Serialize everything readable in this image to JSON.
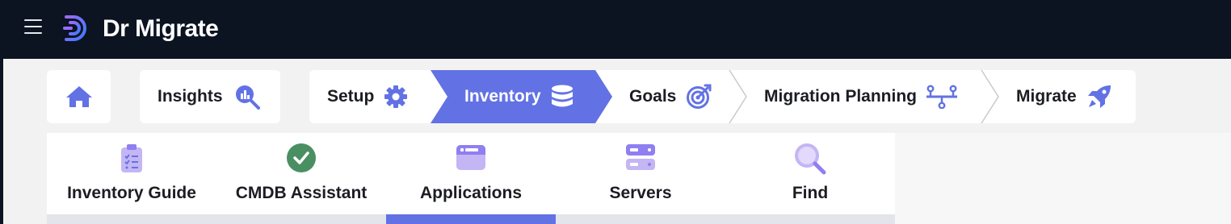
{
  "app": {
    "brand": "Dr Migrate"
  },
  "colors": {
    "accent": "#6272e4",
    "topbar": "#0c1321",
    "success": "#4a8f62",
    "icon_light": "#c4b5f4"
  },
  "breadcrumb": {
    "home": {
      "icon": "home-icon"
    },
    "insights": {
      "label": "Insights",
      "icon": "insights-chart-icon"
    }
  },
  "steps": [
    {
      "label": "Setup",
      "icon": "gear-icon",
      "active": false
    },
    {
      "label": "Inventory",
      "icon": "database-icon",
      "active": true
    },
    {
      "label": "Goals",
      "icon": "target-icon",
      "active": false
    },
    {
      "label": "Migration Planning",
      "icon": "flow-icon",
      "active": false
    },
    {
      "label": "Migrate",
      "icon": "rocket-icon",
      "active": false
    }
  ],
  "subnav": [
    {
      "label": "Inventory Guide",
      "icon": "clipboard-checklist-icon",
      "active": false
    },
    {
      "label": "CMDB Assistant",
      "icon": "check-circle-icon",
      "active": false
    },
    {
      "label": "Applications",
      "icon": "window-icon",
      "active": true
    },
    {
      "label": "Servers",
      "icon": "server-icon",
      "active": false
    },
    {
      "label": "Find",
      "icon": "magnifier-icon",
      "active": false
    }
  ]
}
